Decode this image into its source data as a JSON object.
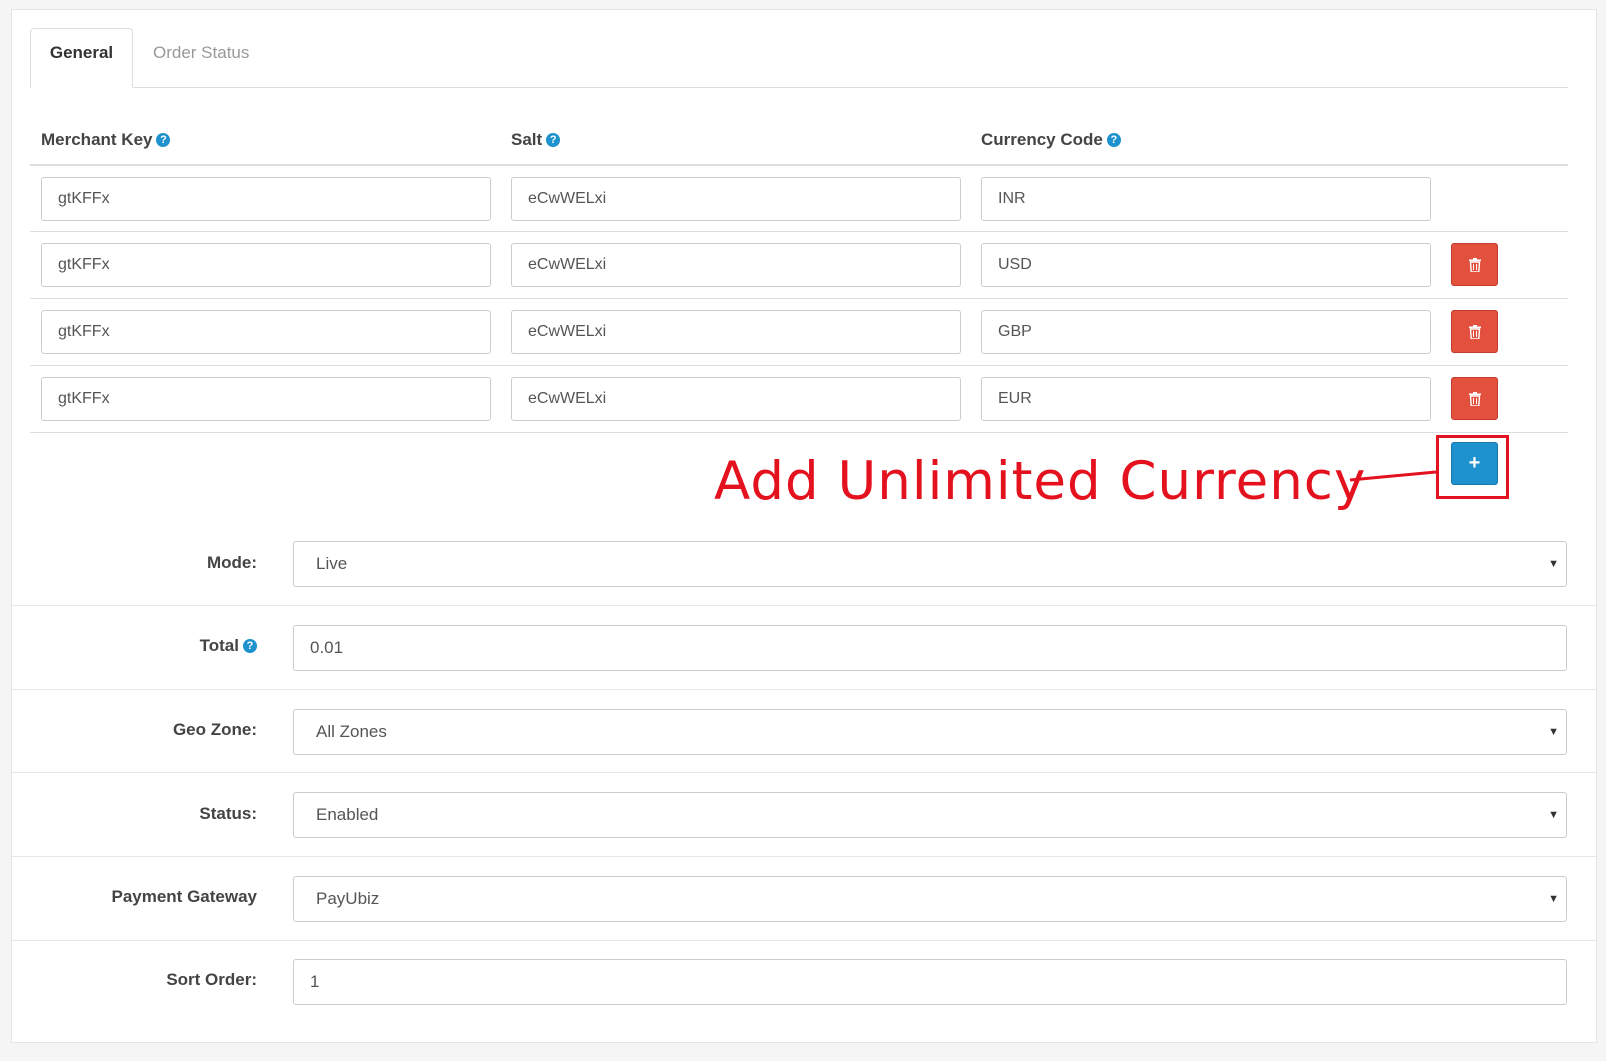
{
  "tabs": [
    {
      "label": "General",
      "active": true
    },
    {
      "label": "Order Status",
      "active": false
    }
  ],
  "table": {
    "headers": {
      "merchant_key": "Merchant Key",
      "salt": "Salt",
      "currency_code": "Currency Code"
    },
    "rows": [
      {
        "merchant_key": "gtKFFx",
        "salt": "eCwWELxi",
        "currency": "INR",
        "removable": false
      },
      {
        "merchant_key": "gtKFFx",
        "salt": "eCwWELxi",
        "currency": "USD",
        "removable": true
      },
      {
        "merchant_key": "gtKFFx",
        "salt": "eCwWELxi",
        "currency": "GBP",
        "removable": true
      },
      {
        "merchant_key": "gtKFFx",
        "salt": "eCwWELxi",
        "currency": "EUR",
        "removable": true
      }
    ]
  },
  "annotation": {
    "text": "Add Unlimited Currency",
    "color": "#e4111e"
  },
  "form": {
    "mode": {
      "label": "Mode:",
      "value": "Live"
    },
    "total": {
      "label": "Total",
      "value": "0.01"
    },
    "geo_zone": {
      "label": "Geo Zone:",
      "value": "All Zones"
    },
    "status": {
      "label": "Status:",
      "value": "Enabled"
    },
    "payment_gateway": {
      "label": "Payment Gateway",
      "value": "PayUbiz"
    },
    "sort_order": {
      "label": "Sort Order:",
      "value": "1"
    }
  },
  "icons": {
    "help": "help-circle-icon",
    "delete": "trash-icon",
    "add": "plus-icon",
    "caret": "caret-down-icon"
  },
  "colors": {
    "primary": "#1e91cf",
    "danger": "#e3503e",
    "annotation": "#e4111e"
  }
}
